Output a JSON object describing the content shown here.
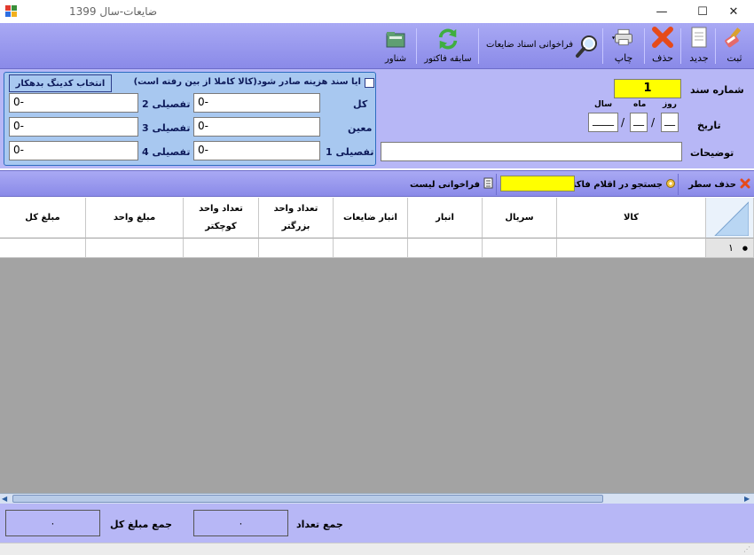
{
  "window": {
    "title": "ضایعات-سال 1399",
    "minimize": "—",
    "maximize": "☐",
    "close": "✕"
  },
  "toolbar": {
    "save_label": "ثبت",
    "new_label": "جدید",
    "delete_label": "حذف",
    "print_label": "چاپ",
    "recall_label": "فراخوانی اسناد ضایعات",
    "history_label": "سابقه فاکتور",
    "float_label": "شناور"
  },
  "form": {
    "doc_number_label": "شماره سند",
    "doc_number_value": "1",
    "date_label": "تاریخ",
    "day_label": "روز",
    "month_label": "ماه",
    "year_label": "سال",
    "date_sep": "/",
    "day_value": "__",
    "month_value": "__",
    "year_value": "____",
    "description_label": "توضیحات",
    "description_value": "",
    "cost_checkbox_label": "آیا سند هزینه صادر شود(کالا کاملا از بین رفته است)",
    "select_coding_button": "انتخاب کدینگ بدهکار",
    "kol_label": "کل",
    "moeen_label": "معین",
    "tafsili1_label": "تفصیلی 1",
    "tafsili2_label": "تفصیلی 2",
    "tafsili3_label": "تفصیلی 3",
    "tafsili4_label": "تفصیلی 4",
    "kol_value": "0-",
    "moeen_value": "0-",
    "tafsili1_value": "0-",
    "tafsili2_value": "0-",
    "tafsili3_value": "0-",
    "tafsili4_value": "0-"
  },
  "tool2": {
    "delete_row_label": "حذف سطر",
    "search_label": "جستجو در اقلام فاکتور",
    "search_value": "",
    "recall_list_label": "فراخوانی لیست"
  },
  "grid": {
    "columns": [
      "کالا",
      "سریال",
      "انبار",
      "انبار ضایعات",
      "تعداد واحد بزرگتر",
      "تعداد واحد کوچکتر",
      "مبلغ واحد",
      "مبلغ کل"
    ],
    "col_bigger_line1": "تعداد واحد",
    "col_bigger_line2": "بزرگتر",
    "col_smaller_line1": "تعداد واحد",
    "col_smaller_line2": "کوچکتر",
    "row1_number": "۱",
    "row1_marker": "●"
  },
  "footer": {
    "total_count_label": "جمع تعداد",
    "total_count_value": "۰",
    "total_amount_label": "جمع مبلغ کل",
    "total_amount_value": "۰"
  },
  "colors": {
    "accent": "#8a8ae8",
    "panel": "#b7b7f6",
    "highlight": "#ffff00",
    "group": "#a8c8f0"
  }
}
